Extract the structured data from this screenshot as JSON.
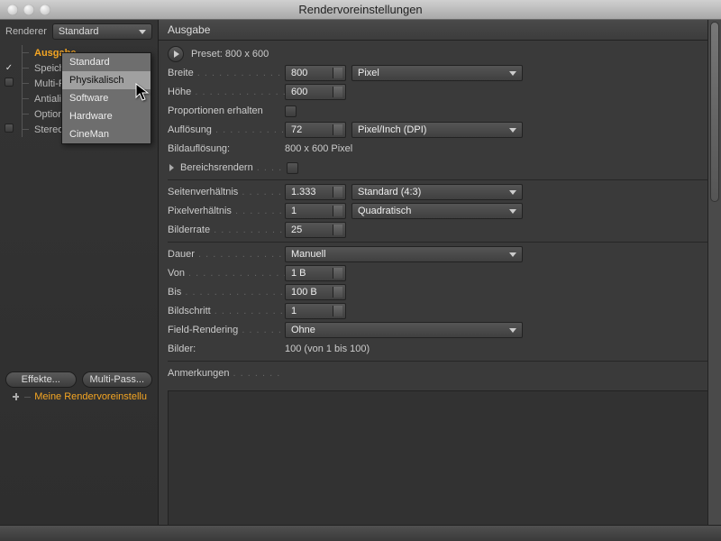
{
  "window": {
    "title": "Rendervoreinstellungen"
  },
  "renderer": {
    "label": "Renderer",
    "selected": "Standard",
    "options": [
      "Standard",
      "Physikalisch",
      "Software",
      "Hardware",
      "CineMan"
    ],
    "hovered": "Physikalisch"
  },
  "tree": {
    "items": [
      {
        "label": "Ausgabe",
        "checked": null,
        "selected": true
      },
      {
        "label": "Speichern",
        "checked": true,
        "selected": false
      },
      {
        "label": "Multi-Pass",
        "checked": false,
        "selected": false
      },
      {
        "label": "Antialiasing",
        "checked": null,
        "selected": false
      },
      {
        "label": "Optionen",
        "checked": null,
        "selected": false
      },
      {
        "label": "Stereoskopie",
        "checked": false,
        "selected": false
      }
    ]
  },
  "buttons": {
    "effects": "Effekte...",
    "multipass": "Multi-Pass..."
  },
  "my_settings": {
    "label": "Meine Rendervoreinstellung"
  },
  "panel": {
    "title": "Ausgabe",
    "preset": {
      "label": "Preset: 800 x 600"
    },
    "width": {
      "label": "Breite",
      "value": "800",
      "unit": "Pixel"
    },
    "height": {
      "label": "Höhe",
      "value": "600"
    },
    "keep_proportions": {
      "label": "Proportionen erhalten",
      "checked": false
    },
    "resolution": {
      "label": "Auflösung",
      "value": "72",
      "unit": "Pixel/Inch (DPI)"
    },
    "image_res": {
      "label": "Bildauflösung:",
      "value": "800 x 600 Pixel"
    },
    "region_render": {
      "label": "Bereichsrendern",
      "checked": false
    },
    "aspect": {
      "label": "Seitenverhältnis",
      "value": "1.333",
      "option": "Standard (4:3)"
    },
    "pixel_aspect": {
      "label": "Pixelverhältnis",
      "value": "1",
      "option": "Quadratisch"
    },
    "framerate": {
      "label": "Bilderrate",
      "value": "25"
    },
    "duration": {
      "label": "Dauer",
      "option": "Manuell"
    },
    "from": {
      "label": "Von",
      "value": "1 B"
    },
    "to": {
      "label": "Bis",
      "value": "100 B"
    },
    "step": {
      "label": "Bildschritt",
      "value": "1"
    },
    "field": {
      "label": "Field-Rendering",
      "option": "Ohne"
    },
    "frames": {
      "label": "Bilder:",
      "value": "100 (von 1 bis 100)"
    },
    "notes": {
      "label": "Anmerkungen"
    }
  }
}
